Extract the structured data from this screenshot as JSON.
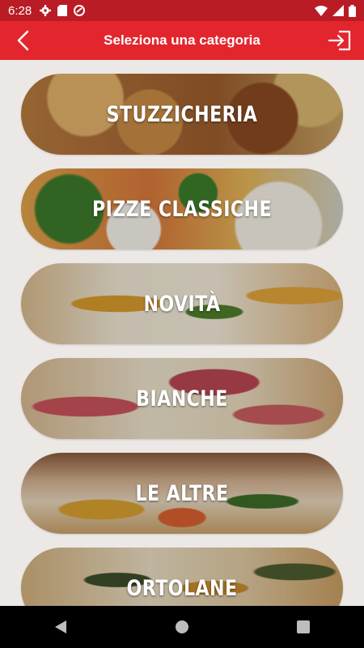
{
  "status_bar": {
    "time": "6:28",
    "icons_left": [
      "settings-icon",
      "sd-card-icon",
      "data-saver-icon"
    ],
    "icons_right": [
      "wifi-icon",
      "signal-icon",
      "battery-icon"
    ]
  },
  "header": {
    "title": "Seleziona una categoria",
    "back_icon": "arrow-left-icon",
    "logout_icon": "logout-icon",
    "background": "#e3262e"
  },
  "categories": [
    {
      "label": "STUZZICHERIA"
    },
    {
      "label": "PIZZE CLASSICHE"
    },
    {
      "label": "NOVITÀ"
    },
    {
      "label": "BIANCHE"
    },
    {
      "label": "LE ALTRE"
    },
    {
      "label": "ORTOLANE"
    }
  ],
  "nav_bar": {
    "icons": [
      "back-triangle-icon",
      "home-circle-icon",
      "recents-square-icon"
    ]
  }
}
